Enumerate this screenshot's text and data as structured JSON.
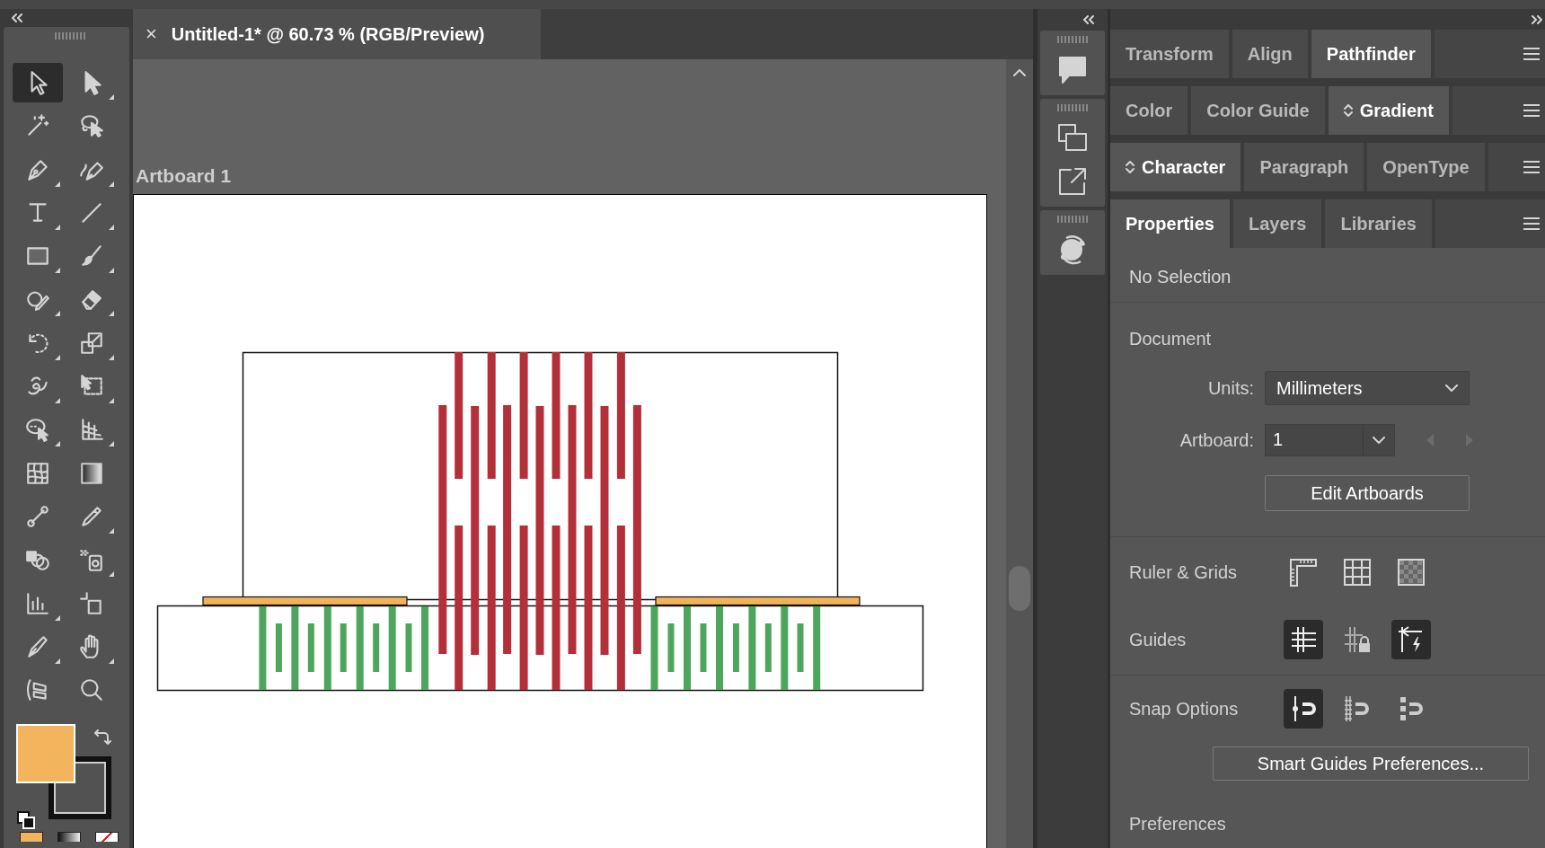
{
  "tools": [
    {
      "selected": true
    },
    {
      "selected": false
    },
    {
      "selected": false
    },
    {
      "selected": false
    },
    {
      "selected": false
    },
    {
      "selected": false
    },
    {
      "selected": false
    },
    {
      "selected": false
    },
    {
      "selected": false
    },
    {
      "selected": false
    },
    {
      "selected": false
    },
    {
      "selected": false
    },
    {
      "selected": false
    },
    {
      "selected": false
    },
    {
      "selected": false
    },
    {
      "selected": false
    },
    {
      "selected": false
    },
    {
      "selected": false
    },
    {
      "selected": false
    },
    {
      "selected": false
    },
    {
      "selected": false
    },
    {
      "selected": false
    },
    {
      "selected": false
    },
    {
      "selected": false
    },
    {
      "selected": false
    },
    {
      "selected": false
    },
    {
      "selected": false
    },
    {
      "selected": false
    },
    {
      "selected": false
    },
    {
      "selected": false
    }
  ],
  "document_tab": {
    "close": "×",
    "title": "Untitled-1* @ 60.73 % (RGB/Preview)"
  },
  "canvas": {
    "artboard_label": "Artboard 1"
  },
  "panel_groups": [
    {
      "tabs": [
        {
          "label": "Transform",
          "selected": false,
          "expandable": false
        },
        {
          "label": "Align",
          "selected": false,
          "expandable": false
        },
        {
          "label": "Pathfinder",
          "selected": true,
          "expandable": false
        }
      ]
    },
    {
      "tabs": [
        {
          "label": "Color",
          "selected": false,
          "expandable": false
        },
        {
          "label": "Color Guide",
          "selected": false,
          "expandable": false
        },
        {
          "label": "Gradient",
          "selected": true,
          "expandable": true
        }
      ]
    },
    {
      "tabs": [
        {
          "label": "Character",
          "selected": true,
          "expandable": true
        },
        {
          "label": "Paragraph",
          "selected": false,
          "expandable": false
        },
        {
          "label": "OpenType",
          "selected": false,
          "expandable": false
        }
      ]
    },
    {
      "tabs": [
        {
          "label": "Properties",
          "selected": true,
          "expandable": false
        },
        {
          "label": "Layers",
          "selected": false,
          "expandable": false
        },
        {
          "label": "Libraries",
          "selected": false,
          "expandable": false
        }
      ]
    }
  ],
  "properties": {
    "status": "No Selection",
    "document": {
      "heading": "Document",
      "units_label": "Units:",
      "units_value": "Millimeters",
      "artboard_label": "Artboard:",
      "artboard_value": "1",
      "artboard_nav": [
        {
          "disabled": true
        },
        {
          "disabled": true
        }
      ],
      "edit_button": "Edit Artboards"
    },
    "ruler_grids": {
      "label": "Ruler & Grids"
    },
    "guides": {
      "label": "Guides",
      "toggles": [
        {
          "on": true
        },
        {
          "on": false
        },
        {
          "on": true
        }
      ]
    },
    "snap_options": {
      "label": "Snap Options",
      "toggles": [
        {
          "on": true
        },
        {
          "on": false
        },
        {
          "on": false
        }
      ]
    },
    "smart_guides_button": "Smart Guides Preferences...",
    "preferences_heading": "Preferences"
  }
}
